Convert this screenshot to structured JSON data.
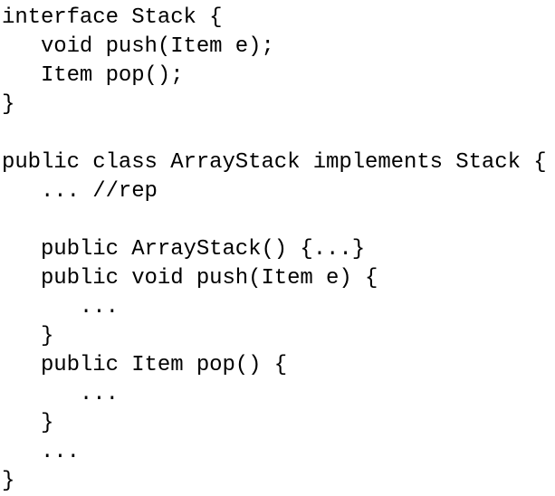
{
  "document": {
    "kind": "code-listing",
    "language": "Java",
    "background_color": "#ffffff",
    "text_color": "#000000",
    "font_size_px": 24,
    "line_height_px": 32,
    "total_lines": 17
  },
  "code": {
    "lines": [
      {
        "n": 1,
        "text": "interface Stack {",
        "indent": 0,
        "blank": false
      },
      {
        "n": 2,
        "text": "   void push(Item e);",
        "indent": 3,
        "blank": false
      },
      {
        "n": 3,
        "text": "   Item pop();",
        "indent": 3,
        "blank": false
      },
      {
        "n": 4,
        "text": "}",
        "indent": 0,
        "blank": false
      },
      {
        "n": 5,
        "text": "",
        "indent": 0,
        "blank": true
      },
      {
        "n": 6,
        "text": "public class ArrayStack implements Stack {",
        "indent": 0,
        "blank": false
      },
      {
        "n": 7,
        "text": "   ... //rep",
        "indent": 3,
        "blank": false
      },
      {
        "n": 8,
        "text": "",
        "indent": 0,
        "blank": true
      },
      {
        "n": 9,
        "text": "   public ArrayStack() {...}",
        "indent": 3,
        "blank": false
      },
      {
        "n": 10,
        "text": "   public void push(Item e) {",
        "indent": 3,
        "blank": false
      },
      {
        "n": 11,
        "text": "      ...",
        "indent": 6,
        "blank": false
      },
      {
        "n": 12,
        "text": "   }",
        "indent": 3,
        "blank": false
      },
      {
        "n": 13,
        "text": "   public Item pop() {",
        "indent": 3,
        "blank": false
      },
      {
        "n": 14,
        "text": "      ...",
        "indent": 6,
        "blank": false
      },
      {
        "n": 15,
        "text": "   }",
        "indent": 3,
        "blank": false
      },
      {
        "n": 16,
        "text": "   ...",
        "indent": 3,
        "blank": false
      },
      {
        "n": 17,
        "text": "}",
        "indent": 0,
        "blank": false
      }
    ]
  }
}
